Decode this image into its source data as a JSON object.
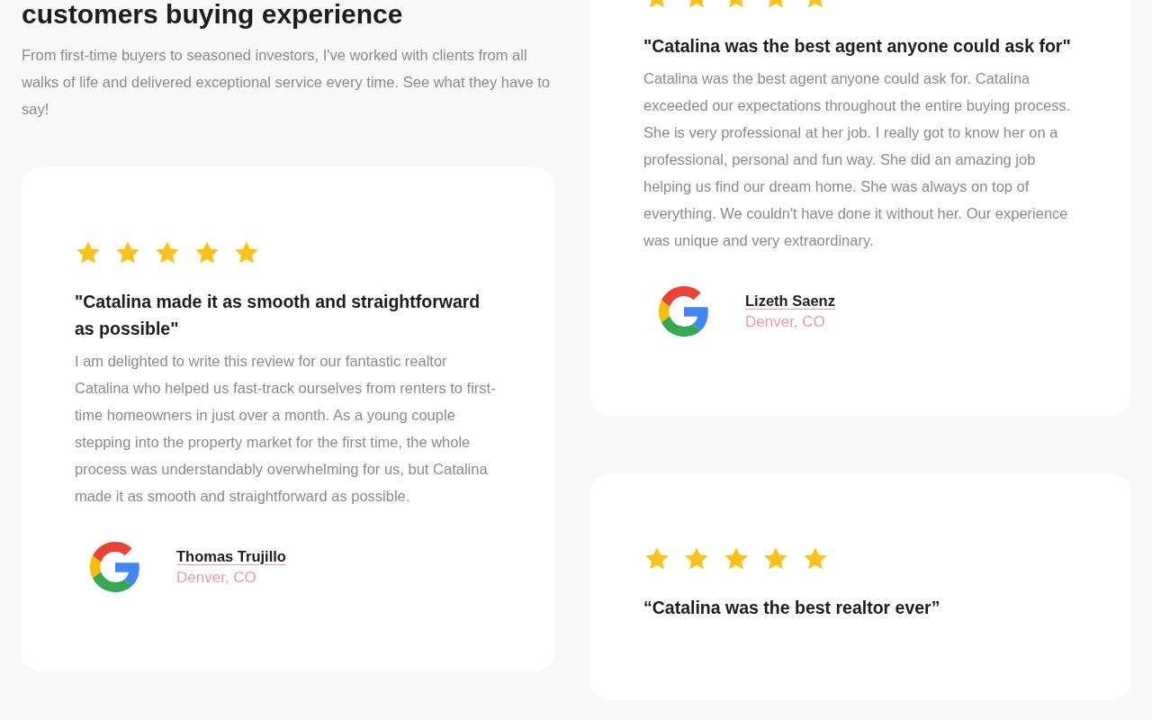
{
  "intro": {
    "heading": "customers buying experience",
    "text": "From first-time buyers to seasoned investors, I've worked with clients from all walks of life and delivered exceptional service every time. See what they have to say!"
  },
  "reviews": [
    {
      "stars": 5,
      "title": "\"Catalina made it as smooth and straightforward as possible\"",
      "text": "I am delighted to write this review for our fantastic realtor Catalina who helped us fast-track ourselves from renters to first-time homeowners in just over a month. As a young couple stepping into the property market for the first time, the whole process was understandably overwhelming for us, but Catalina made it as smooth and straightforward as possible.",
      "name": "Thomas Trujillo",
      "location": "Denver, CO"
    },
    {
      "stars": 5,
      "title": "\"Catalina was the best agent anyone could ask for\"",
      "text": "Catalina was the best agent anyone could ask for. Catalina exceeded our expectations throughout the entire buying process. She is very professional at her job. I really got to know her on a professional, personal and fun way. She did an amazing job helping us find our dream home. She was always on top of everything. We couldn't have done it without her. Our experience was unique and very extraordinary.",
      "name": "Lizeth Saenz",
      "location": "Denver, CO"
    },
    {
      "stars": 5,
      "title": "“Catalina was the best realtor ever”"
    }
  ]
}
